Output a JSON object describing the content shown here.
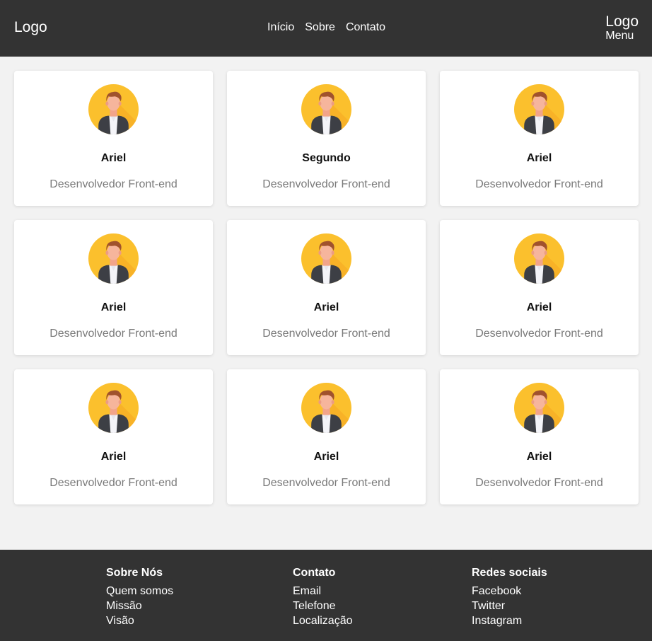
{
  "header": {
    "logo_left": "Logo",
    "nav": [
      "Início",
      "Sobre",
      "Contato"
    ],
    "logo_right": "Logo",
    "menu": "Menu"
  },
  "cards": [
    {
      "name": "Ariel",
      "role": "Desenvolvedor Front-end"
    },
    {
      "name": "Segundo",
      "role": "Desenvolvedor Front-end"
    },
    {
      "name": "Ariel",
      "role": "Desenvolvedor Front-end"
    },
    {
      "name": "Ariel",
      "role": "Desenvolvedor Front-end"
    },
    {
      "name": "Ariel",
      "role": "Desenvolvedor Front-end"
    },
    {
      "name": "Ariel",
      "role": "Desenvolvedor Front-end"
    },
    {
      "name": "Ariel",
      "role": "Desenvolvedor Front-end"
    },
    {
      "name": "Ariel",
      "role": "Desenvolvedor Front-end"
    },
    {
      "name": "Ariel",
      "role": "Desenvolvedor Front-end"
    }
  ],
  "footer": {
    "columns": [
      {
        "title": "Sobre Nós",
        "links": [
          "Quem somos",
          "Missão",
          "Visão"
        ]
      },
      {
        "title": "Contato",
        "links": [
          "Email",
          "Telefone",
          "Localização"
        ]
      },
      {
        "title": "Redes sociais",
        "links": [
          "Facebook",
          "Twitter",
          "Instagram"
        ]
      }
    ]
  },
  "icons": {
    "avatar": "user-avatar-icon"
  },
  "colors": {
    "header_bg": "#333333",
    "page_bg": "#f2f2f2",
    "avatar_bg": "#fbc02d",
    "role_text": "#7a7a7a"
  }
}
